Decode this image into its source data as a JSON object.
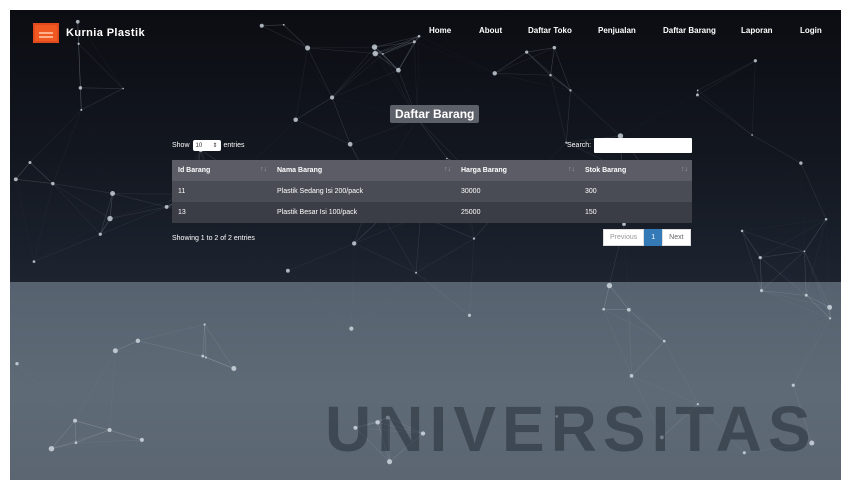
{
  "brand": {
    "name": "Kurnia Plastik",
    "logo_icon": "logo-icon",
    "accent": "#f05a22"
  },
  "nav": {
    "items": [
      "Home",
      "About",
      "Daftar Toko",
      "Penjualan",
      "Daftar Barang",
      "Laporan",
      "Login"
    ]
  },
  "page": {
    "title": "Daftar Barang"
  },
  "controls": {
    "show_label": "Show",
    "entries_value": "10",
    "entries_label": "entries",
    "search_label": "Search:",
    "search_value": ""
  },
  "table": {
    "headers": [
      "Id Barang",
      "Nama Barang",
      "Harga Barang",
      "Stok Barang"
    ],
    "sort_icon": "↑↓",
    "rows": [
      [
        "11",
        "Plastik Sedang Isi 200/pack",
        "30000",
        "300"
      ],
      [
        "13",
        "Plastik Besar Isi 100/pack",
        "25000",
        "150"
      ]
    ]
  },
  "footer": {
    "info": "Showing 1 to 2 of 2 entries"
  },
  "pagination": {
    "previous": "Previous",
    "current": "1",
    "next": "Next",
    "active_color": "#337ab7"
  },
  "watermark": {
    "text": "UNIVERSITAS"
  }
}
